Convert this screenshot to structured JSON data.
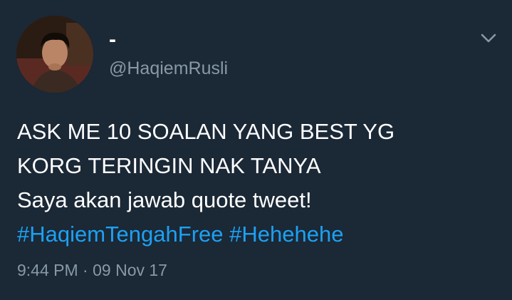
{
  "author": {
    "display_name": "-",
    "handle": "@HaqiemRusli"
  },
  "tweet": {
    "lines": [
      "ASK ME 10 SOALAN YANG BEST YG",
      "KORG TERINGIN NAK TANYA",
      "Saya akan jawab quote tweet!"
    ],
    "hashtags": [
      "#HaqiemTengahFree",
      "#Hehehehe"
    ],
    "time": "9:44 PM",
    "separator": "·",
    "date": "09 Nov 17"
  },
  "icons": {
    "menu": "chevron-down-icon",
    "avatar": "profile-photo"
  },
  "colors": {
    "background": "#1b2836",
    "text": "#ffffff",
    "secondary": "#8899a6",
    "link": "#1da1f2"
  }
}
